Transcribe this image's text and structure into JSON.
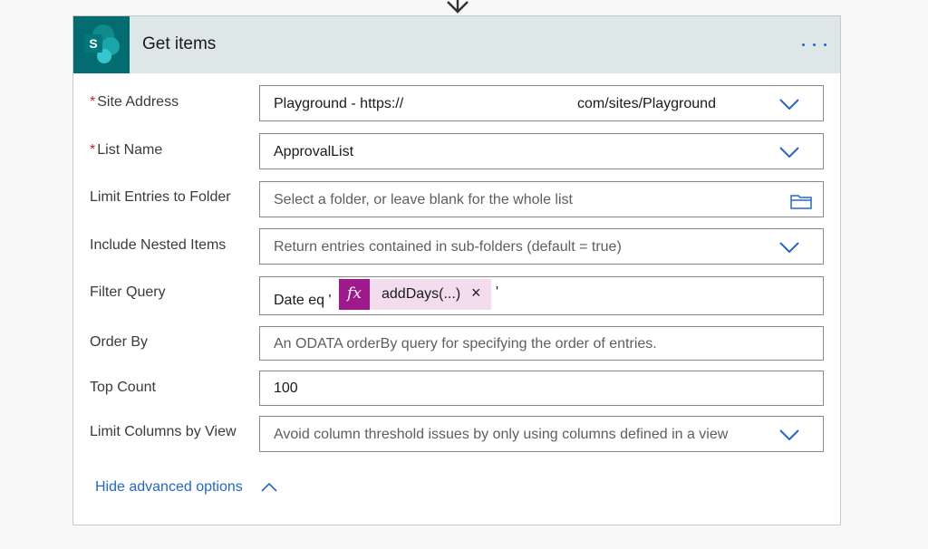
{
  "colors": {
    "accent": "#2266d0",
    "header_bg": "#dde7e8",
    "connector_bg": "#036c70",
    "required": "#c4262e",
    "fx_token": "#9e1a8c",
    "fx_token_bg": "#f2dcee"
  },
  "card": {
    "title": "Get items",
    "connector_icon": "sharepoint-icon",
    "connector_letter": "S",
    "more_icon": "more-options-icon"
  },
  "fields": {
    "site_address": {
      "label": "Site Address",
      "required_mark": "*",
      "value_prefix": "Playground - https://",
      "value_suffix": "com/sites/Playground"
    },
    "list_name": {
      "label": "List Name",
      "required_mark": "*",
      "value": "ApprovalList"
    },
    "limit_entries_folder": {
      "label": "Limit Entries to Folder",
      "placeholder": "Select a folder, or leave blank for the whole list",
      "icon": "folder-icon"
    },
    "include_nested_items": {
      "label": "Include Nested Items",
      "placeholder": "Return entries contained in sub-folders (default = true)"
    },
    "filter_query": {
      "label": "Filter Query",
      "text_before": "Date eq '",
      "token_icon": "fx",
      "token_label": "addDays(...)",
      "token_close": "×",
      "text_after": "'"
    },
    "order_by": {
      "label": "Order By",
      "placeholder": "An ODATA orderBy query for specifying the order of entries."
    },
    "top_count": {
      "label": "Top Count",
      "value": "100"
    },
    "limit_columns_view": {
      "label": "Limit Columns by View",
      "placeholder": "Avoid column threshold issues by only using columns defined in a view"
    }
  },
  "advanced": {
    "label": "Hide advanced options"
  }
}
